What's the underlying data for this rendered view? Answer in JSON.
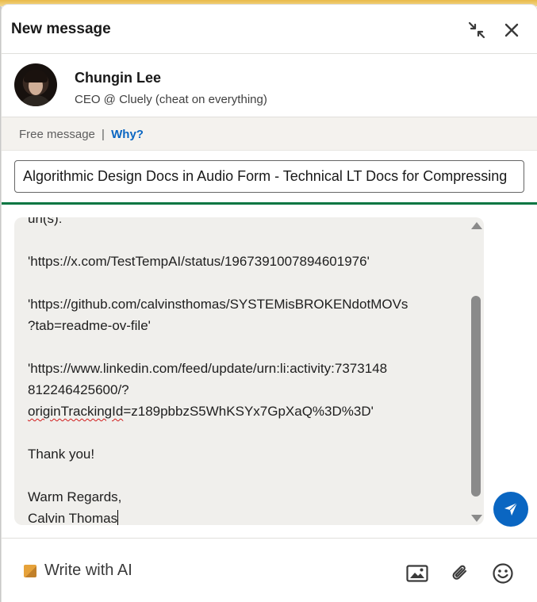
{
  "window": {
    "title": "New message",
    "minimize_icon": "minimize-arrows-icon",
    "close_icon": "close-icon"
  },
  "recipient": {
    "name": "Chungin Lee",
    "headline": "CEO @ Cluely (cheat on everything)"
  },
  "free_message": {
    "label": "Free message",
    "separator": "|",
    "link": "Why?"
  },
  "subject": {
    "value": "Algorithmic Design Docs in Audio Form - Technical LT Docs for Compressing"
  },
  "body": {
    "lines": [
      "url(s):",
      "",
      "'https://x.com/TestTempAI/status/1967391007894601976'",
      "",
      "'https://github.com/calvinsthomas/SYSTEMisBROKENdotMOVs",
      "?tab=readme-ov-file'",
      "",
      "'https://www.linkedin.com/feed/update/urn:li:activity:7373148",
      "812246425600/?"
    ],
    "tracking_misspelled": "originTrackingId",
    "tracking_rest": "=z189pbbzS5WhKSYx7GpXaQ%3D%3D'",
    "closing_lines": [
      "",
      "Thank you!",
      "",
      "Warm Regards,",
      "Calvin Thomas"
    ],
    "scroll_position": 0.62
  },
  "footer": {
    "ai_label": "Write with AI",
    "icons": [
      "image-icon",
      "paperclip-icon",
      "emoji-icon"
    ]
  },
  "colors": {
    "accent": "#0a66c2",
    "divider_green": "#057642"
  }
}
